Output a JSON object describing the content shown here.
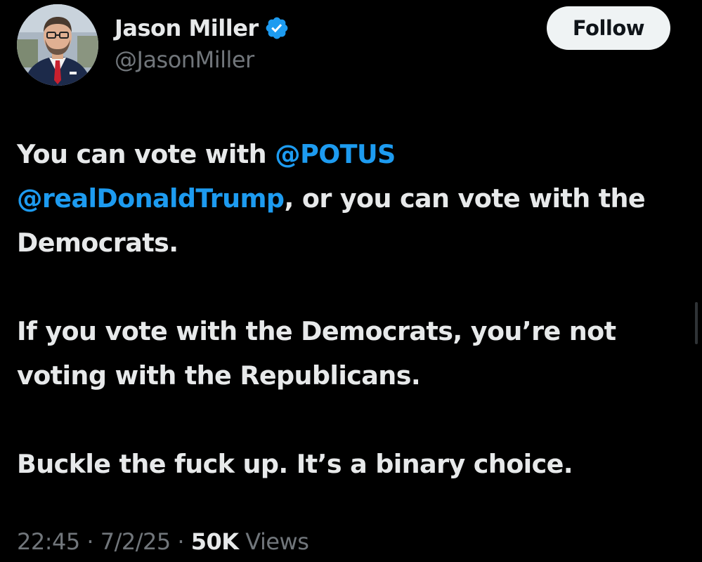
{
  "author": {
    "display_name": "Jason Miller",
    "handle": "@JasonMiller",
    "verified": true,
    "avatar_icon": "profile-photo"
  },
  "follow_button": {
    "label": "Follow"
  },
  "tweet": {
    "paragraphs": [
      {
        "segments": [
          {
            "text": "You can vote with ",
            "type": "text"
          },
          {
            "text": "@POTUS",
            "type": "mention"
          },
          {
            "text": " ",
            "type": "text"
          },
          {
            "text": "@realDonaldTrump",
            "type": "mention"
          },
          {
            "text": ", or you can vote with the Democrats.",
            "type": "text"
          }
        ]
      },
      {
        "segments": [
          {
            "text": "If you vote with the Democrats, you’re not voting with the Republicans.",
            "type": "text"
          }
        ]
      },
      {
        "segments": [
          {
            "text": "Buckle the fuck up. It’s a binary choice.",
            "type": "text"
          }
        ]
      }
    ]
  },
  "meta": {
    "time": "22:45",
    "separator": " · ",
    "date": "7/2/25",
    "views_count": "50K",
    "views_label": " Views"
  },
  "colors": {
    "background": "#000000",
    "text_primary": "#e7e9ea",
    "text_secondary": "#71767b",
    "accent": "#1d9bf0",
    "button_bg": "#eff3f4"
  }
}
